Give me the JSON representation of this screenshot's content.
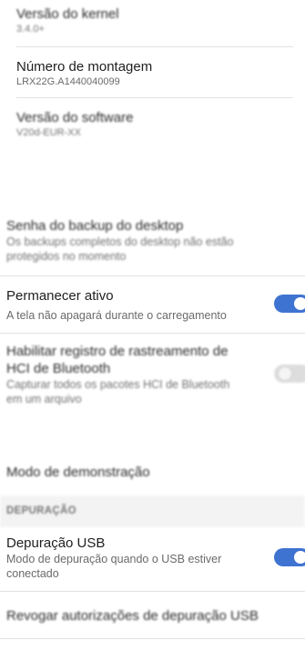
{
  "device_info": {
    "kernel": {
      "label": "Versão do kernel",
      "value": "3.4.0+"
    },
    "build_number": {
      "label": "Número de montagem",
      "value": "LRX22G.A1440040099"
    },
    "software": {
      "label": "Versão do software",
      "value": "V20d-EUR-XX"
    }
  },
  "desktop_backup": {
    "title": "Senha do backup do desktop",
    "subtitle_line1": "Os backups completos do desktop não estão",
    "subtitle_line2": "protegidos no momento"
  },
  "stay_awake": {
    "title": "Permanecer ativo",
    "subtitle": "A tela não apagará durante o carregamento",
    "enabled": true
  },
  "hci_log": {
    "title_line1": "Habilitar registro de rastreamento de",
    "title_line2": "HCI de Bluetooth",
    "subtitle_line1": "Capturar todos os pacotes HCI de Bluetooth",
    "subtitle_line2": "em um arquivo",
    "enabled": false
  },
  "demo_mode": {
    "title": "Modo de demonstração"
  },
  "debugging_section": {
    "header": "DEPURAÇÃO"
  },
  "usb_debugging": {
    "title": "Depuração USB",
    "subtitle_line1": "Modo de depuração quando o USB estiver",
    "subtitle_line2": "conectado",
    "enabled": true
  },
  "revoke_usb": {
    "title": "Revogar autorizações de depuração USB"
  },
  "colors": {
    "accent": "#3f73d1",
    "section_background": "#f3f3f3",
    "divider": "#e2e2e2"
  }
}
